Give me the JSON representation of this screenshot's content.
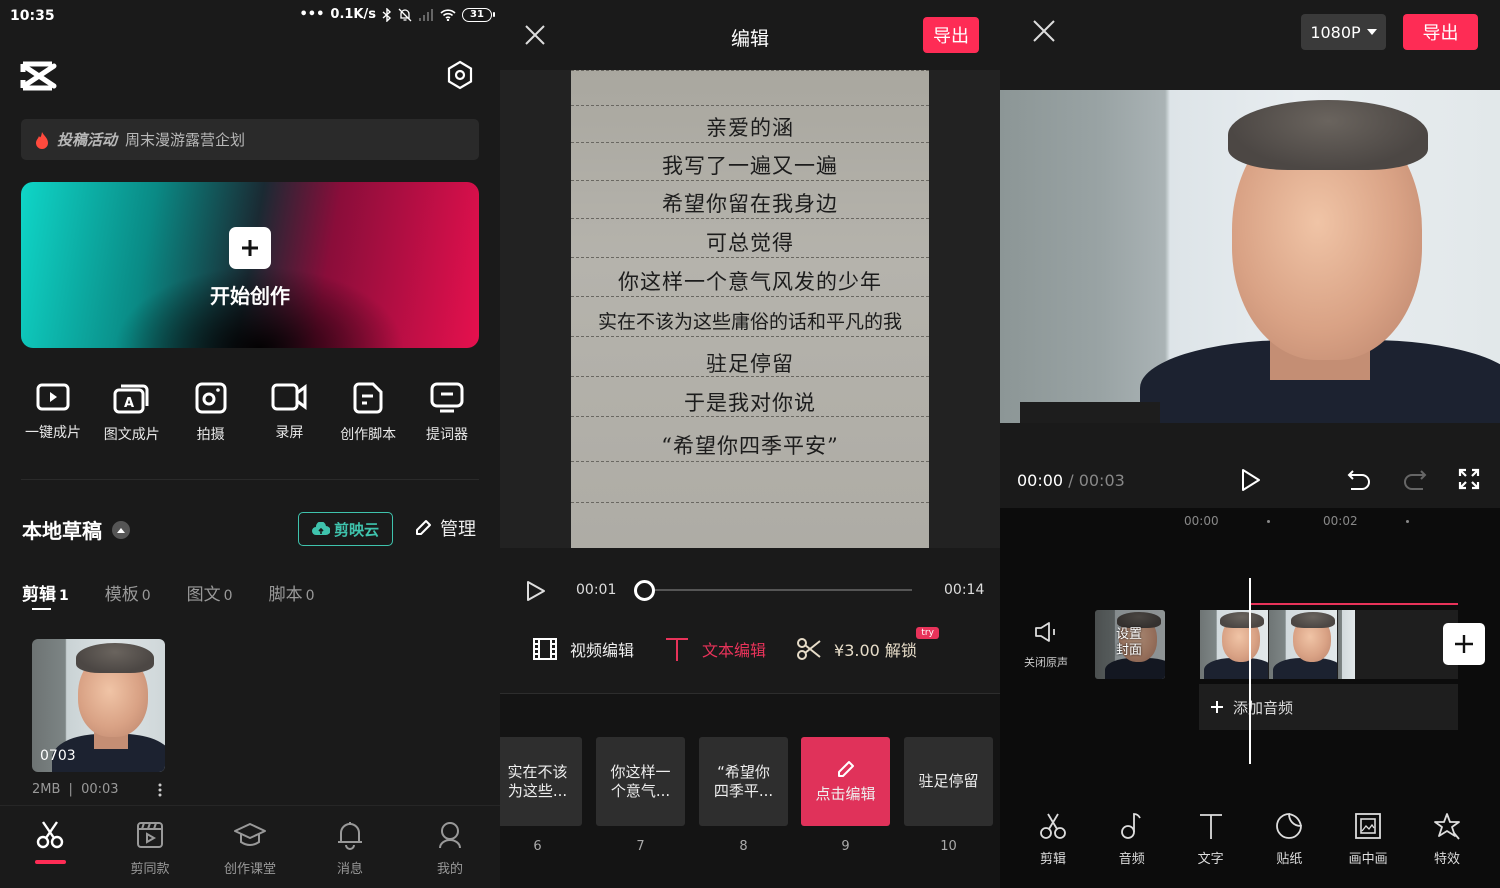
{
  "home": {
    "status_bar": {
      "time": "10:35",
      "network_speed": "0.1K/s",
      "battery": "31",
      "icons": [
        "more-dots-icon",
        "bluetooth-icon",
        "mute-bell-icon",
        "signal-icon",
        "wifi-icon",
        "battery-icon"
      ]
    },
    "logo_icon": "capcut-logo-icon",
    "settings_icon": "settings-hexagon-icon",
    "promo": {
      "tag": "投稿活动",
      "text": "周末漫游露营企划",
      "icon": "flame-icon"
    },
    "create": {
      "label": "开始创作",
      "icon": "plus-icon",
      "gradient_left": "#0fd6c8",
      "gradient_right": "#e6104e"
    },
    "tools": [
      {
        "label": "一键成片",
        "icon": "auto-video-icon"
      },
      {
        "label": "图文成片",
        "icon": "text-to-video-icon"
      },
      {
        "label": "拍摄",
        "icon": "camera-icon"
      },
      {
        "label": "录屏",
        "icon": "screen-record-icon"
      },
      {
        "label": "创作脚本",
        "icon": "script-icon"
      },
      {
        "label": "提词器",
        "icon": "teleprompter-icon"
      }
    ],
    "drafts": {
      "title": "本地草稿",
      "cloud_label": "剪映云",
      "manage_label": "管理",
      "tabs": [
        {
          "label": "剪辑",
          "count": "1",
          "active": true
        },
        {
          "label": "模板",
          "count": "0",
          "active": false
        },
        {
          "label": "图文",
          "count": "0",
          "active": false
        },
        {
          "label": "脚本",
          "count": "0",
          "active": false
        }
      ],
      "items": [
        {
          "name": "0703",
          "size": "2MB",
          "duration": "00:03"
        }
      ]
    },
    "bottom_nav": [
      {
        "label": "",
        "icon": "scissors-icon",
        "active": true
      },
      {
        "label": "剪同款",
        "icon": "template-clapper-icon",
        "active": false
      },
      {
        "label": "创作课堂",
        "icon": "graduation-cap-icon",
        "active": false
      },
      {
        "label": "消息",
        "icon": "bell-icon",
        "active": false
      },
      {
        "label": "我的",
        "icon": "profile-icon",
        "active": false
      }
    ],
    "accent": "#fe2c55",
    "cloud_color": "#3fc3ad"
  },
  "text_editor": {
    "title": "编辑",
    "export_label": "导出",
    "paper_lines": [
      "亲爱的涵",
      "我写了一遍又一遍",
      "希望你留在我身边",
      "可总觉得",
      "你这样一个意气风发的少年",
      "实在不该为这些庸俗的话和平凡的我",
      "驻足停留",
      "于是我对你说",
      "“希望你四季平安”"
    ],
    "player": {
      "current": "00:01",
      "total": "00:14",
      "progress_fraction": 0.0
    },
    "modes": [
      {
        "label": "视频编辑",
        "icon": "film-icon",
        "active": false
      },
      {
        "label": "文本编辑",
        "icon": "text-t-icon",
        "active": true
      },
      {
        "label": "¥3.00 解锁",
        "icon": "scissors-icon",
        "active": false,
        "badge": "try"
      }
    ],
    "segments": [
      {
        "line1": "实在不该",
        "line2": "为这些...",
        "num": "6",
        "active": false
      },
      {
        "line1": "你这样一",
        "line2": "个意气...",
        "num": "7",
        "active": false
      },
      {
        "line1": "“希望你",
        "line2": "四季平...",
        "num": "8",
        "active": false
      },
      {
        "line1": "点击编辑",
        "line2": "",
        "num": "9",
        "active": true
      },
      {
        "line1": "驻足停留",
        "line2": "",
        "num": "10",
        "active": false
      }
    ]
  },
  "video_editor": {
    "resolution": "1080P",
    "export_label": "导出",
    "time_current": "00:00",
    "time_separator": "/",
    "time_total": "00:03",
    "ruler": [
      "00:00",
      "00:02"
    ],
    "mute_label": "关闭原声",
    "cover_label_1": "设置",
    "cover_label_2": "封面",
    "add_audio_label": "添加音频",
    "tools": [
      {
        "label": "剪辑",
        "icon": "scissors-icon"
      },
      {
        "label": "音频",
        "icon": "music-note-icon"
      },
      {
        "label": "文字",
        "icon": "text-t-icon"
      },
      {
        "label": "贴纸",
        "icon": "sticker-icon"
      },
      {
        "label": "画中画",
        "icon": "picture-in-picture-icon"
      },
      {
        "label": "特效",
        "icon": "effects-star-icon"
      }
    ]
  }
}
